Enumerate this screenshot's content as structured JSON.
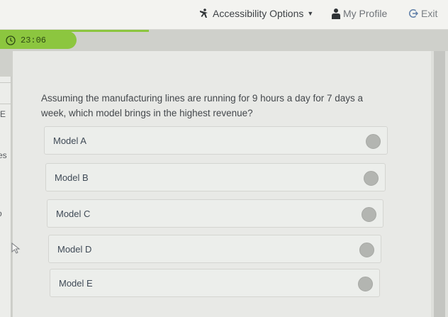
{
  "topbar": {
    "accessibility_label": "Accessibility Options",
    "profile_label": "My Profile",
    "exit_label": "Exit"
  },
  "timer": {
    "time": "23:06"
  },
  "sidebar": {
    "fragments": [
      "E",
      "es",
      "o"
    ]
  },
  "question": {
    "text": "Assuming the manufacturing lines are running for 9 hours a day for 7 days a week, which model brings in the highest revenue?"
  },
  "options": [
    {
      "label": "Model A"
    },
    {
      "label": "Model B"
    },
    {
      "label": "Model C"
    },
    {
      "label": "Model D"
    },
    {
      "label": "Model E"
    }
  ],
  "colors": {
    "timer_green": "#8cc63f",
    "radio_gray": "#b3b5b1"
  }
}
